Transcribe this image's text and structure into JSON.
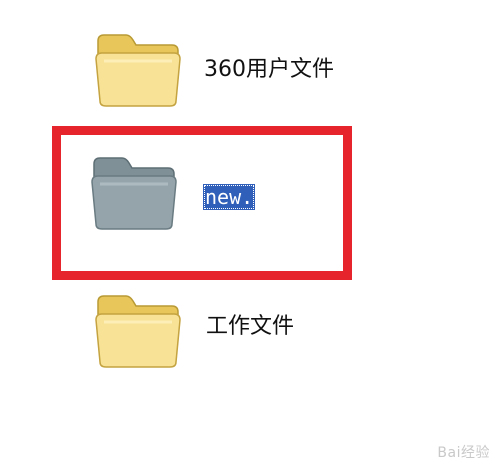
{
  "folders": [
    {
      "label": "360用户文件",
      "icon": "folder-icon",
      "state": "normal"
    },
    {
      "label": "new.",
      "icon": "folder-icon",
      "state": "renaming-selected"
    },
    {
      "label": "工作文件",
      "icon": "folder-icon",
      "state": "normal"
    }
  ],
  "watermark": "Bai经验",
  "colors": {
    "folder_yellow": "#f6de84",
    "folder_selected": "#8fa0a6",
    "selection_blue": "#2f5fb8",
    "highlight_red": "#e5242b"
  }
}
